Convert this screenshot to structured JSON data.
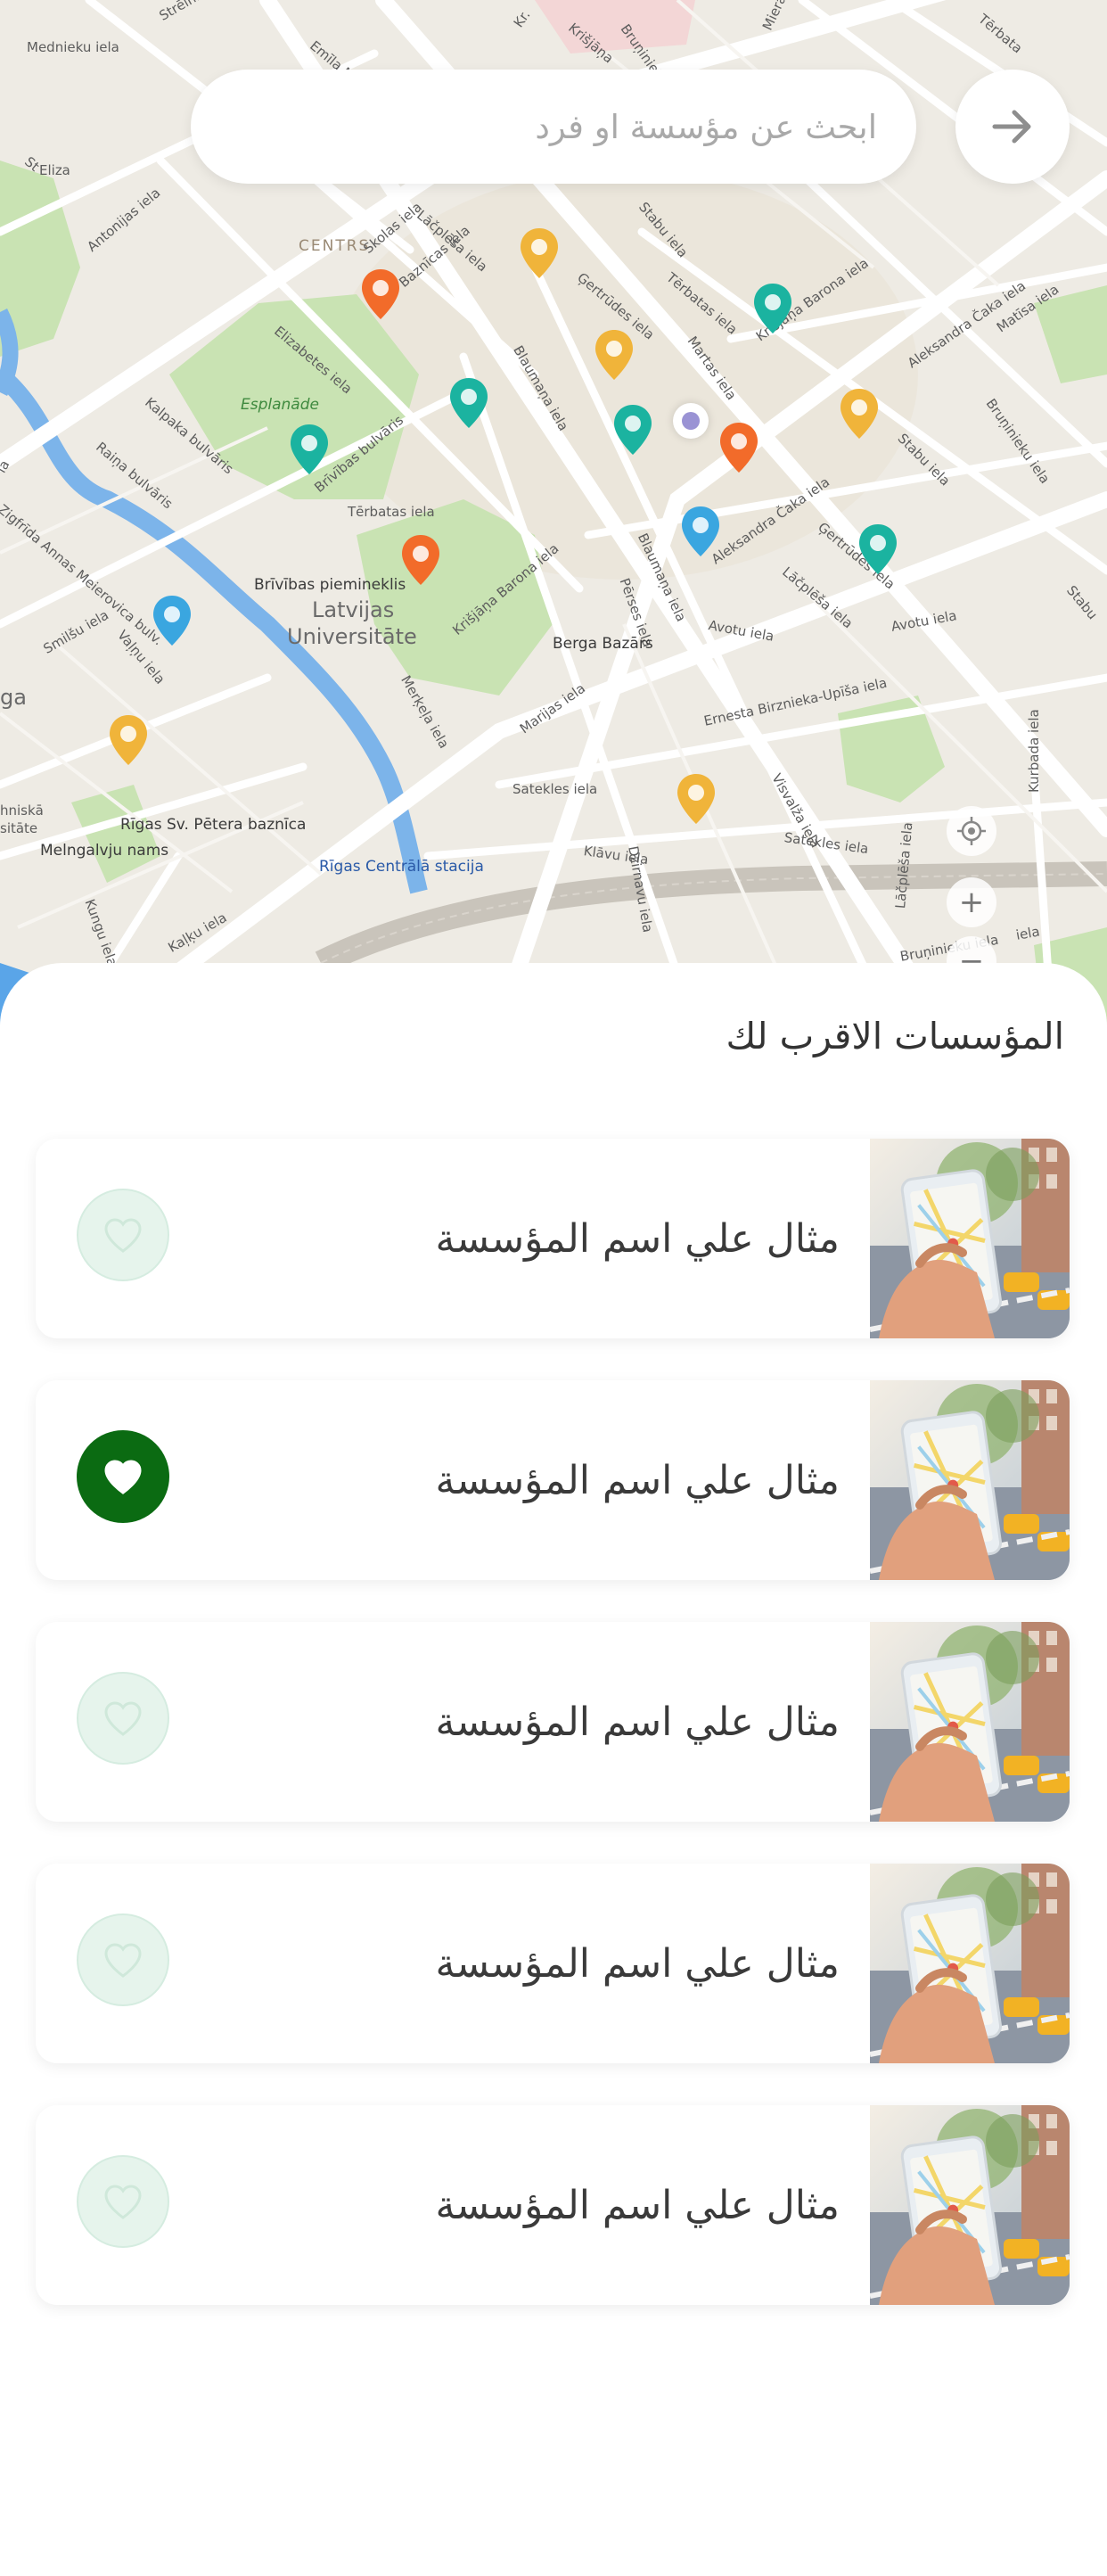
{
  "search": {
    "placeholder": "ابحث عن مؤسسة او فرد",
    "submit_icon": "arrow-right-icon"
  },
  "map": {
    "labels": {
      "centrs": "CENTRS",
      "esplanade": "Esplanāde",
      "latvijas": "Latvijas",
      "universitate": "Universitāte",
      "brivibas_piemineklis": "Brīvības piemineklis",
      "berga_bazars": "Berga Bazārs",
      "rigas_petera": "Rīgas Sv. Pētera baznīca",
      "melngalvju": "Melngalvju nams",
      "rigas_stacija": "Rīgas Centrālā stacija",
      "satekles": "Satekles iela",
      "satekles2": "Satekles iela",
      "avotu": "Avotu iela",
      "avotu2": "Avotu iela",
      "marijas": "Marijas iela",
      "tallinas": "Tērbatas iela",
      "elizabetes": "Elizabetes iela",
      "brivibas_bulv": "Brīvības bulvāris",
      "raina": "Raiņa bulvāris",
      "kalpaka": "Kalpaka bulvāris",
      "krisjana": "Krišjāņa Barona iela",
      "krisjana2": "Krišjāņa Barona iela",
      "gertrudes": "Ģertrūdes iela",
      "blaumana": "Blaumaņa iela",
      "blaumana2": "Blaumaņa iela",
      "aleksandra": "Aleksandra Čaka iela",
      "aleksandra2": "Aleksandra Čaka iela",
      "stabu": "Stabu iela",
      "stabu2": "Stabu iela",
      "lacplesa": "Lāčplēša iela",
      "lacplesa2": "Lāčplēša iela",
      "lacplesa3": "Lāčplēša iela",
      "ernesta": "Ernesta Birznieka-Upīša iela",
      "merkela": "Merķeļa iela",
      "dzirnavu": "Dzirnavu iela",
      "klavu": "Klāvu iela",
      "visvalza": "Visvalža iela",
      "kurbada": "Kurbada iela",
      "matisa": "Matīsa iela",
      "bruninieku": "Bruņinieku iela",
      "perses": "Pērses iela",
      "martas": "Martas iela",
      "skolas": "Skolas iela",
      "baznicas": "Baznīcas iela",
      "antonijas": "Antonijas iela",
      "valnu": "Vaļņu iela",
      "smilsu": "Smilšu iela",
      "zigfrida": "Zigfrīda Annas Meierovica bulv.",
      "kungu": "Kungu iela",
      "kalku": "Kaļķu iela",
      "mednieku": "Mednieku iela",
      "strelnieku": "Strēlnieku",
      "emila": "Emīla Melngaiļa",
      "kr": "Kr.",
      "krisjana_top": "Krišjāņa",
      "brun_top": "Bruņinieku iela",
      "stabu_top": "Stabu iela",
      "terbatas2": "Tērbatas iela",
      "ga": "ga",
      "niska": "hniskā",
      "sitate": "sitāte",
      "la": "la",
      "st": "St",
      "eliz": "Eliza",
      "iela": "iela",
      "mier": "Miera",
      "terb_tr": "Tērbata",
      "stabu_r": "Stabu"
    },
    "controls": {
      "locate": "locate-icon",
      "zoom_in": "+",
      "zoom_out": "−"
    }
  },
  "nearby": {
    "title": "المؤسسات الاقرب لك",
    "items": [
      {
        "name": "مثال علي اسم المؤسسة",
        "favorite": false
      },
      {
        "name": "مثال علي اسم المؤسسة",
        "favorite": true
      },
      {
        "name": "مثال علي اسم المؤسسة",
        "favorite": false
      },
      {
        "name": "مثال علي اسم المؤسسة",
        "favorite": false
      },
      {
        "name": "مثال علي اسم المؤسسة",
        "favorite": false
      }
    ]
  },
  "colors": {
    "favorite_active": "#0b6b12",
    "favorite_inactive_bg": "#e6f4ec",
    "favorite_inactive_icon": "#cfe8da",
    "pin_yellow": "#f0b43a",
    "pin_teal": "#1bb3a0",
    "pin_orange": "#f26b2a",
    "pin_blue": "#3aa6e0"
  }
}
